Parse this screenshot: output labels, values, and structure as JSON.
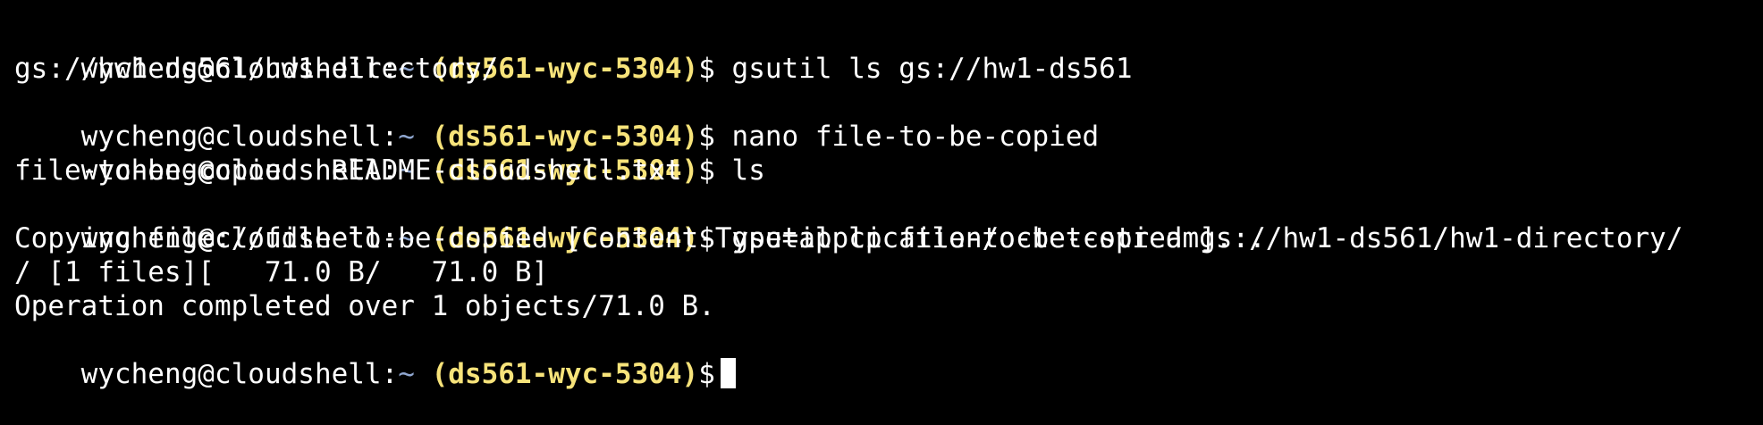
{
  "prompt": {
    "user_host": "wycheng@cloudshell:",
    "dir": "~",
    "project": " (ds561-wyc-5304)",
    "symbol": "$"
  },
  "lines": [
    {
      "type": "prompt",
      "command": " gsutil ls gs://hw1-ds561"
    },
    {
      "type": "output",
      "text": "gs://hw1-ds561/hw1-directory/"
    },
    {
      "type": "prompt",
      "command": " nano file-to-be-copied"
    },
    {
      "type": "prompt",
      "command": " ls"
    },
    {
      "type": "output",
      "text": "file-to-be-copied  README-cloudshell.txt"
    },
    {
      "type": "prompt",
      "command": " gsutil cp file-to-be-copied gs://hw1-ds561/hw1-directory/"
    },
    {
      "type": "output",
      "text": "Copying file://file-to-be-copied [Content-Type=application/octet-stream]..."
    },
    {
      "type": "output",
      "text": "/ [1 files][   71.0 B/   71.0 B]"
    },
    {
      "type": "output",
      "text": "Operation completed over 1 objects/71.0 B."
    },
    {
      "type": "prompt",
      "command": " ",
      "cursor": true
    }
  ],
  "colors": {
    "background": "#000000",
    "text": "#ffffff",
    "project": "#f7e37a",
    "tilde": "#8fa6cf"
  }
}
